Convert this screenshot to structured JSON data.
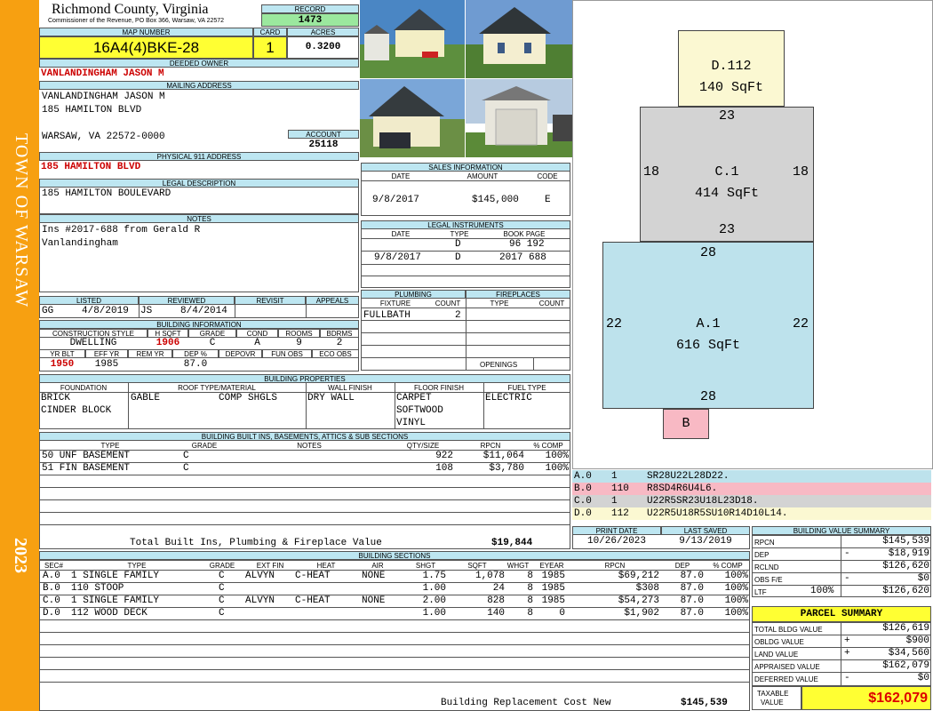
{
  "sidebar": {
    "town": "TOWN OF WARSAW",
    "year": "2023"
  },
  "header": {
    "county": "Richmond County, Virginia",
    "commissioner": "Commissioner of the Revenue, PO Box 366, Warsaw, VA 22572",
    "record_label": "RECORD",
    "record": "1473",
    "map_label": "MAP NUMBER",
    "map_number": "16A4(4)BKE-28",
    "card_label": "CARD",
    "card": "1",
    "acres_label": "ACRES",
    "acres": "0.3200"
  },
  "owner": {
    "deeded_label": "DEEDED OWNER",
    "deeded": "VANLANDINGHAM JASON M",
    "mailing_label": "MAILING ADDRESS",
    "mail_line1": "VANLANDINGHAM JASON M",
    "mail_line2": "185 HAMILTON BLVD",
    "mail_line3": "WARSAW, VA 22572-0000",
    "account_label": "ACCOUNT",
    "account": "25118",
    "physical_label": "PHYSICAL 911 ADDRESS",
    "physical": "185 HAMILTON BLVD",
    "legal_label": "LEGAL DESCRIPTION",
    "legal": "185 HAMILTON BOULEVARD",
    "notes_label": "NOTES",
    "notes1": "Ins #2017-688 from Gerald R",
    "notes2": "Vanlandingham"
  },
  "sales": {
    "label": "SALES INFORMATION",
    "h_date": "DATE",
    "h_amount": "AMOUNT",
    "h_code": "CODE",
    "date": "9/8/2017",
    "amount": "$145,000",
    "code": "E"
  },
  "instruments": {
    "label": "LEGAL INSTRUMENTS",
    "h_date": "DATE",
    "h_type": "TYPE",
    "h_book": "BOOK PAGE",
    "rows": [
      {
        "date": "",
        "type": "D",
        "book": "96 192"
      },
      {
        "date": "9/8/2017",
        "type": "D",
        "book": "2017 688"
      }
    ]
  },
  "plumbing": {
    "label": "PLUMBING",
    "h_fixture": "FIXTURE",
    "h_count": "COUNT",
    "fixture": "FULLBATH",
    "count": "2"
  },
  "fireplaces": {
    "label": "FIREPLACES",
    "h_type": "TYPE",
    "h_count": "COUNT",
    "openings": "OPENINGS"
  },
  "listing": {
    "h_listed": "LISTED",
    "h_reviewed": "REVIEWED",
    "h_revisit": "REVISIT",
    "h_appeals": "APPEALS",
    "listed_by": "GG",
    "listed_date": "4/8/2019",
    "reviewed_by": "JS",
    "reviewed_date": "8/4/2014"
  },
  "building_info": {
    "label": "BUILDING INFORMATION",
    "h_style": "CONSTRUCTION STYLE",
    "h_hsqft": "H SQFT",
    "h_grade": "GRADE",
    "h_cond": "COND",
    "h_rooms": "ROOMS",
    "h_bdrms": "BDRMS",
    "style": "DWELLING",
    "hsqft": "1906",
    "grade": "C",
    "cond": "A",
    "rooms": "9",
    "bdrms": "2",
    "h_yrblt": "YR BLT",
    "h_effyr": "EFF YR",
    "h_remyr": "REM YR",
    "h_dep": "DEP %",
    "h_depovr": "DEPOVR",
    "h_funobs": "FUN OBS",
    "h_ecoobs": "ECO OBS",
    "yrblt": "1950",
    "effyr": "1985",
    "dep": "87.0"
  },
  "properties": {
    "label": "BUILDING PROPERTIES",
    "h_foundation": "FOUNDATION",
    "h_roof": "ROOF TYPE/MATERIAL",
    "h_wall": "WALL FINISH",
    "h_floor": "FLOOR FINISH",
    "h_fuel": "FUEL TYPE",
    "foundation1": "BRICK",
    "foundation2": "CINDER BLOCK",
    "roof_type": "GABLE",
    "roof_material": "COMP SHGLS",
    "wall": "DRY WALL",
    "floor1": "CARPET",
    "floor2": "SOFTWOOD",
    "floor3": "VINYL",
    "fuel": "ELECTRIC"
  },
  "builtins": {
    "label": "BUILDING BUILT INS, BASEMENTS, ATTICS & SUB SECTIONS",
    "h_type": "TYPE",
    "h_grade": "GRADE",
    "h_notes": "NOTES",
    "h_qty": "QTY/SIZE",
    "h_rpcn": "RPCN",
    "h_comp": "% COMP",
    "rows": [
      {
        "type": "50 UNF BASEMENT",
        "grade": "C",
        "qty": "922",
        "rpcn": "$11,064",
        "comp": "100%"
      },
      {
        "type": "51 FIN BASEMENT",
        "grade": "C",
        "qty": "108",
        "rpcn": "$3,780",
        "comp": "100%"
      }
    ],
    "total_label": "Total Built Ins, Plumbing & Fireplace Value",
    "total": "$19,844"
  },
  "sketch": {
    "areas": [
      {
        "code": "D.112",
        "sqft": "140 SqFt"
      },
      {
        "code": "C.1",
        "sqft": "414 SqFt",
        "top": "23",
        "bottom": "23",
        "left": "18",
        "right": "18"
      },
      {
        "code": "A.1",
        "sqft": "616 SqFt",
        "top": "28",
        "bottom": "28",
        "left": "22",
        "right": "22"
      },
      {
        "code": "B"
      }
    ]
  },
  "legend": [
    {
      "code": "A.0",
      "num": "1",
      "path": "SR28U22L28D22.",
      "color": "#bde2ec"
    },
    {
      "code": "B.0",
      "num": "110",
      "path": "R8SD4R6U4L6.",
      "color": "#f8b9c4"
    },
    {
      "code": "C.0",
      "num": "1",
      "path": "U22R5SR23U18L23D18.",
      "color": "#d3d3d3"
    },
    {
      "code": "D.0",
      "num": "112",
      "path": "U22R5U18R5SU10R14D10L14.",
      "color": "#fbf8d2"
    }
  ],
  "dates": {
    "h_print": "PRINT DATE",
    "h_saved": "LAST SAVED",
    "print": "10/26/2023",
    "saved": "9/13/2019"
  },
  "sections": {
    "label": "BUILDING SECTIONS",
    "h_sec": "SEC#",
    "h_type": "TYPE",
    "h_grade": "GRADE",
    "h_extfin": "EXT FIN",
    "h_heat": "HEAT",
    "h_air": "AIR",
    "h_shgt": "SHGT",
    "h_sqft": "SQFT",
    "h_whgt": "WHGT",
    "h_eyear": "EYEAR",
    "h_rpcn": "RPCN",
    "h_dep": "DEP",
    "h_comp": "% COMP",
    "rows": [
      {
        "sec": "A.0",
        "type": "1 SINGLE FAMILY",
        "grade": "C",
        "ext": "ALVYN",
        "heat": "C-HEAT",
        "air": "NONE",
        "shgt": "1.75",
        "sqft": "1,078",
        "whgt": "8",
        "eyear": "1985",
        "rpcn": "$69,212",
        "dep": "87.0",
        "comp": "100%"
      },
      {
        "sec": "B.0",
        "type": "110 STOOP",
        "grade": "C",
        "ext": "",
        "heat": "",
        "air": "",
        "shgt": "1.00",
        "sqft": "24",
        "whgt": "8",
        "eyear": "1985",
        "rpcn": "$308",
        "dep": "87.0",
        "comp": "100%"
      },
      {
        "sec": "C.0",
        "type": "1 SINGLE FAMILY",
        "grade": "C",
        "ext": "ALVYN",
        "heat": "C-HEAT",
        "air": "NONE",
        "shgt": "2.00",
        "sqft": "828",
        "whgt": "8",
        "eyear": "1985",
        "rpcn": "$54,273",
        "dep": "87.0",
        "comp": "100%"
      },
      {
        "sec": "D.0",
        "type": "112 WOOD DECK",
        "grade": "C",
        "ext": "",
        "heat": "",
        "air": "",
        "shgt": "1.00",
        "sqft": "140",
        "whgt": "8",
        "eyear": "0",
        "rpcn": "$1,902",
        "dep": "87.0",
        "comp": "100%"
      }
    ],
    "replacement_label": "Building Replacement Cost New",
    "replacement": "$145,539"
  },
  "value_summary": {
    "label": "BUILDING VALUE SUMMARY",
    "rows": [
      {
        "label": "RPCN",
        "sign": "",
        "value": "$145,539"
      },
      {
        "label": "DEP",
        "sign": "-",
        "value": "$18,919"
      },
      {
        "label": "RCLND",
        "sign": "",
        "value": "$126,620"
      },
      {
        "label": "OBS F/E",
        "sign": "-",
        "value": "$0"
      },
      {
        "label": "LTF",
        "pct": "100%",
        "sign": "",
        "value": "$126,620"
      }
    ]
  },
  "parcel": {
    "label": "PARCEL SUMMARY",
    "rows": [
      {
        "label": "TOTAL BLDG VALUE",
        "sign": "",
        "value": "$126,619"
      },
      {
        "label": "OBLDG VALUE",
        "sign": "+",
        "value": "$900"
      },
      {
        "label": "LAND VALUE",
        "sign": "+",
        "value": "$34,560"
      },
      {
        "label": "APPRAISED VALUE",
        "sign": "",
        "value": "$162,079"
      },
      {
        "label": "DEFERRED VALUE",
        "sign": "-",
        "value": "$0"
      }
    ],
    "taxable_label1": "TAXABLE",
    "taxable_label2": "VALUE",
    "taxable": "$162,079"
  }
}
